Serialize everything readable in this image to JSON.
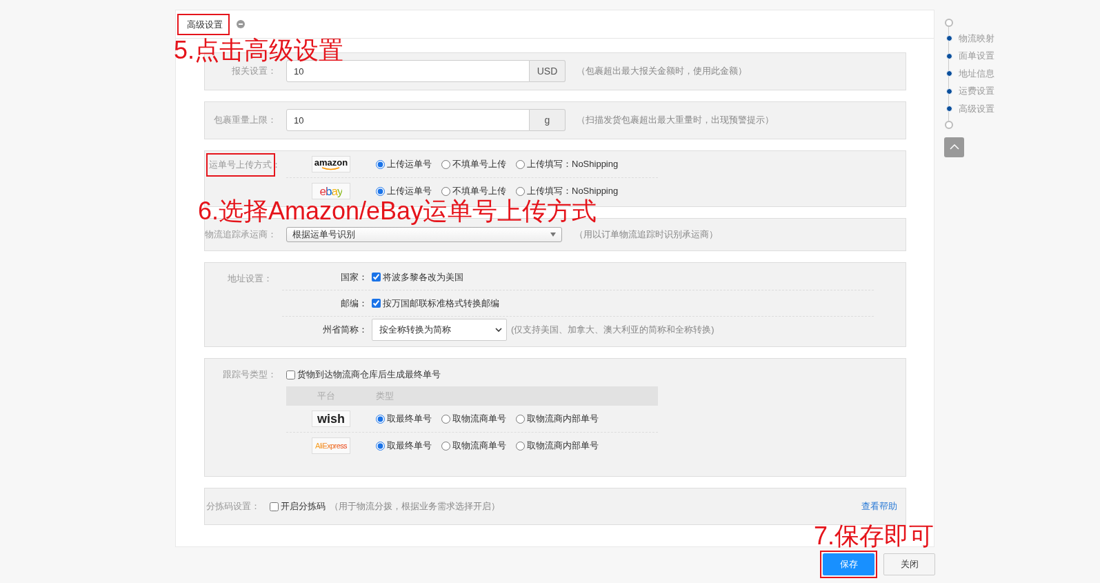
{
  "panel": {
    "title": "高级设置",
    "highlighted": true
  },
  "customs": {
    "label": "报关设置：",
    "value": "10",
    "unit": "USD",
    "hint": "（包裹超出最大报关金额时，使用此金额）"
  },
  "weight_limit": {
    "label": "包裹重量上限：",
    "value": "10",
    "unit": "g",
    "hint": "（扫描发货包裹超出最大重量时，出现预警提示）"
  },
  "upload_method": {
    "label": "运单号上传方式：",
    "highlighted": true,
    "platforms": [
      {
        "kind": "amazon",
        "logo": "amazon",
        "options": [
          {
            "label": "上传运单号",
            "selected": true
          },
          {
            "label": "不填单号上传",
            "selected": false
          },
          {
            "label": "上传填写：NoShipping",
            "selected": false
          }
        ]
      },
      {
        "kind": "ebay",
        "logo": "ebay",
        "options": [
          {
            "label": "上传运单号",
            "selected": true
          },
          {
            "label": "不填单号上传",
            "selected": false
          },
          {
            "label": "上传填写：NoShipping",
            "selected": false
          }
        ]
      }
    ]
  },
  "carrier": {
    "label": "物流追踪承运商：",
    "value": "根据运单号识别",
    "hint": "（用以订单物流追踪时识别承运商）"
  },
  "address": {
    "label": "地址设置：",
    "rows": [
      {
        "kind": "checkbox",
        "label": "国家：",
        "option": "将波多黎各改为美国",
        "checked": true
      },
      {
        "kind": "checkbox",
        "label": "邮编：",
        "option": "按万国邮联标准格式转换邮编",
        "checked": true
      },
      {
        "kind": "select",
        "label": "州省简称：",
        "value": "按全称转换为简称",
        "hint": "(仅支持美国、加拿大、澳大利亚的简称和全称转换)"
      }
    ]
  },
  "tracking": {
    "label": "跟踪号类型：",
    "checkbox": {
      "label": "货物到达物流商仓库后生成最终单号",
      "checked": false
    },
    "columns": [
      "平台",
      "类型"
    ],
    "platforms": [
      {
        "kind": "wish",
        "logo": "wish",
        "options": [
          {
            "label": "取最终单号",
            "selected": true
          },
          {
            "label": "取物流商单号",
            "selected": false
          },
          {
            "label": "取物流商内部单号",
            "selected": false
          }
        ]
      },
      {
        "kind": "aliexpress",
        "logo": "AliExpress",
        "options": [
          {
            "label": "取最终单号",
            "selected": true
          },
          {
            "label": "取物流商单号",
            "selected": false
          },
          {
            "label": "取物流商内部单号",
            "selected": false
          }
        ]
      }
    ]
  },
  "sorting": {
    "label": "分拣码设置：",
    "checkbox": {
      "label": "开启分拣码",
      "checked": false
    },
    "hint": "（用于物流分拨，根据业务需求选择开启）",
    "help_link": "查看帮助"
  },
  "buttons": [
    {
      "label": "保存",
      "kind": "primary",
      "highlighted": true
    },
    {
      "label": "关闭",
      "kind": "default",
      "highlighted": false
    }
  ],
  "nav": {
    "items": [
      "物流映射",
      "面单设置",
      "地址信息",
      "运费设置",
      "高级设置"
    ]
  },
  "annotations": [
    {
      "kind": "step5",
      "text": "5.点击高级设置"
    },
    {
      "kind": "step6",
      "text": "6.选择Amazon/eBay运单号上传方式"
    },
    {
      "kind": "step7",
      "text": "7.保存即可"
    }
  ]
}
